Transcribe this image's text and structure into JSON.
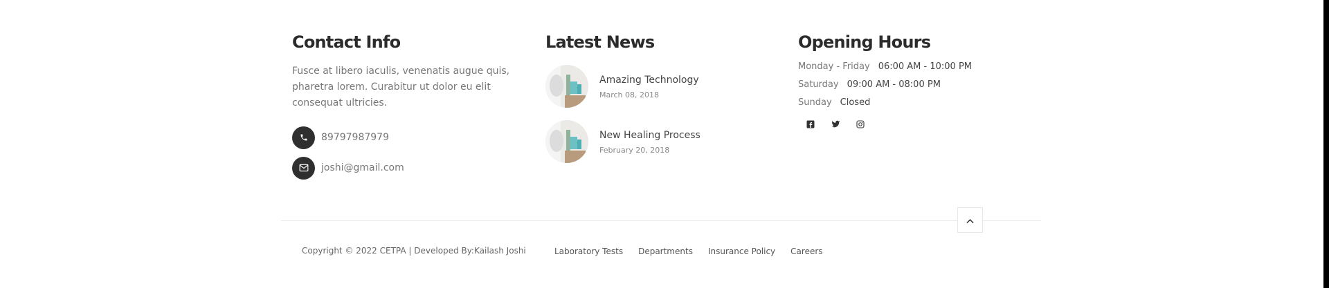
{
  "contact": {
    "title": "Contact Info",
    "text": "Fusce at libero iaculis, venenatis augue quis, pharetra lorem. Curabitur ut dolor eu elit consequat ultricies.",
    "phone": "89797987979",
    "email": "joshi@gmail.com"
  },
  "news": {
    "title": "Latest News",
    "items": [
      {
        "title": "Amazing Technology",
        "date": "March 08, 2018"
      },
      {
        "title": "New Healing Process",
        "date": "February 20, 2018"
      }
    ]
  },
  "hours": {
    "title": "Opening Hours",
    "rows": [
      {
        "day": "Monday - Friday",
        "time": "06:00 AM - 10:00 PM"
      },
      {
        "day": "Saturday",
        "time": "09:00 AM - 08:00 PM"
      },
      {
        "day": "Sunday",
        "time": "Closed"
      }
    ],
    "social": [
      "facebook-icon",
      "twitter-icon",
      "instagram-icon"
    ]
  },
  "footer": {
    "copyright": "Copyright © 2022 CETPA | Developed By:Kailash Joshi",
    "links": [
      "Laboratory Tests",
      "Departments",
      "Insurance Policy",
      "Careers"
    ]
  }
}
